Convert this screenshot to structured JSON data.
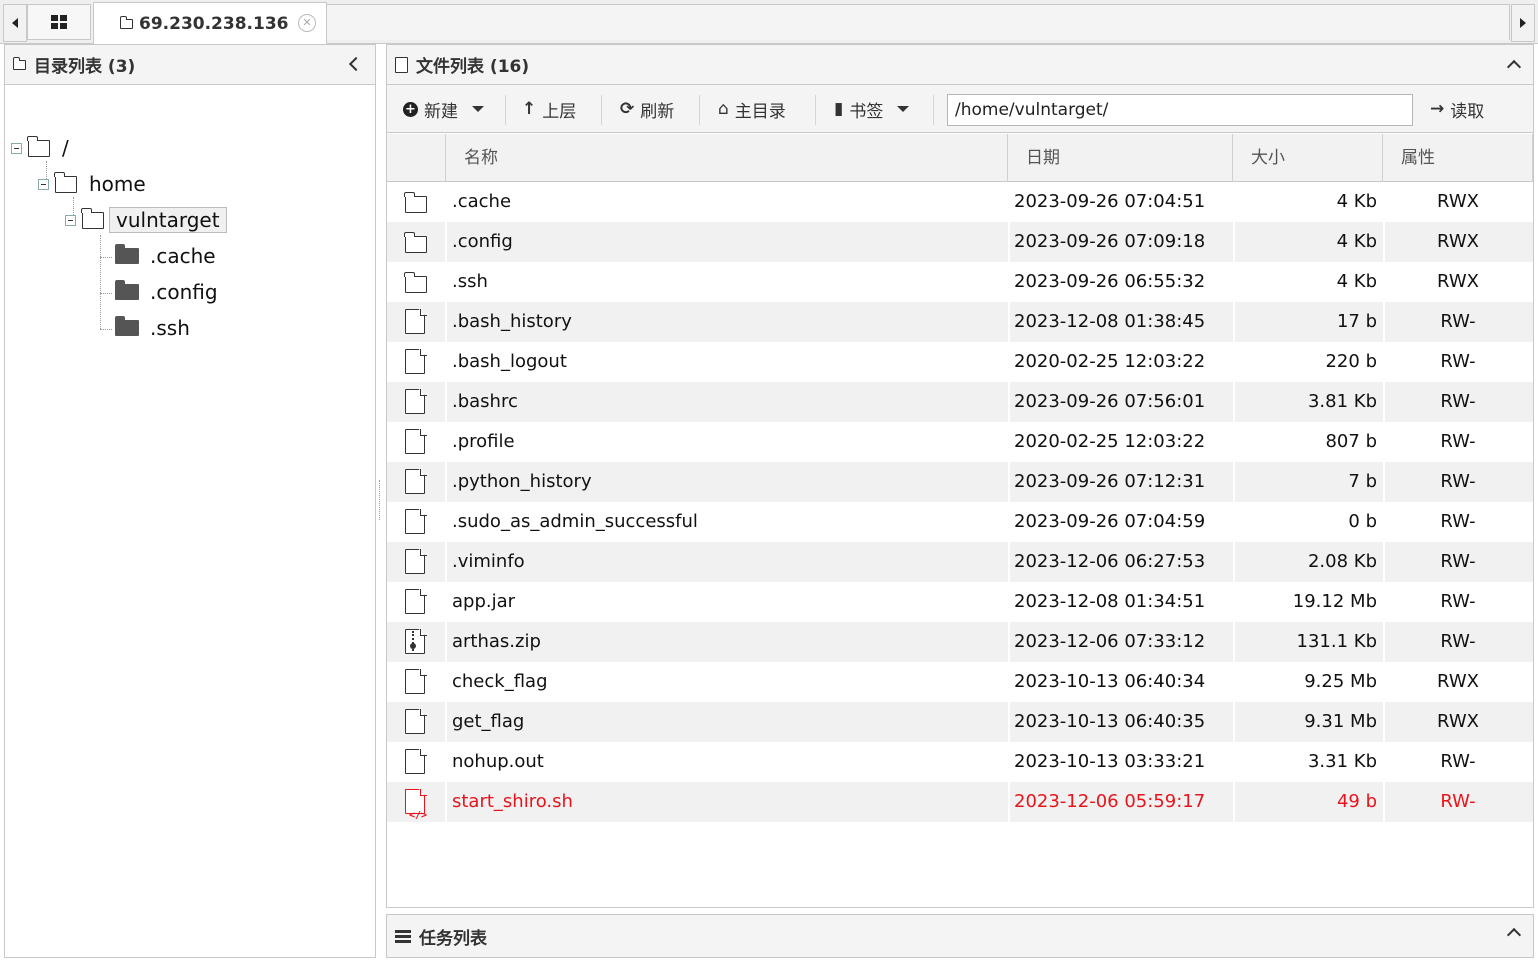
{
  "tabs": {
    "host_label": "69.230.238.136"
  },
  "left": {
    "title": "目录列表 (3)",
    "tree": {
      "root": "/",
      "home": "home",
      "user": "vulntarget",
      "children": [
        ".cache",
        ".config",
        ".ssh"
      ]
    }
  },
  "right": {
    "title": "文件列表 (16)",
    "toolbar": {
      "new_label": "新建",
      "up_label": "上层",
      "refresh_label": "刷新",
      "home_label": "主目录",
      "bookmark_label": "书签",
      "path_value": "/home/vulntarget/",
      "read_label": "读取"
    },
    "columns": [
      "名称",
      "日期",
      "大小",
      "属性"
    ],
    "files": [
      {
        "name": ".cache",
        "date": "2023-09-26 07:04:51",
        "size": "4 Kb",
        "attr": "RWX",
        "type": "folder"
      },
      {
        "name": ".config",
        "date": "2023-09-26 07:09:18",
        "size": "4 Kb",
        "attr": "RWX",
        "type": "folder"
      },
      {
        "name": ".ssh",
        "date": "2023-09-26 06:55:32",
        "size": "4 Kb",
        "attr": "RWX",
        "type": "folder"
      },
      {
        "name": ".bash_history",
        "date": "2023-12-08 01:38:45",
        "size": "17 b",
        "attr": "RW-",
        "type": "file"
      },
      {
        "name": ".bash_logout",
        "date": "2020-02-25 12:03:22",
        "size": "220 b",
        "attr": "RW-",
        "type": "file"
      },
      {
        "name": ".bashrc",
        "date": "2023-09-26 07:56:01",
        "size": "3.81 Kb",
        "attr": "RW-",
        "type": "file"
      },
      {
        "name": ".profile",
        "date": "2020-02-25 12:03:22",
        "size": "807 b",
        "attr": "RW-",
        "type": "file"
      },
      {
        "name": ".python_history",
        "date": "2023-09-26 07:12:31",
        "size": "7 b",
        "attr": "RW-",
        "type": "file"
      },
      {
        "name": ".sudo_as_admin_successful",
        "date": "2023-09-26 07:04:59",
        "size": "0 b",
        "attr": "RW-",
        "type": "file"
      },
      {
        "name": ".viminfo",
        "date": "2023-12-06 06:27:53",
        "size": "2.08 Kb",
        "attr": "RW-",
        "type": "file"
      },
      {
        "name": "app.jar",
        "date": "2023-12-08 01:34:51",
        "size": "19.12 Mb",
        "attr": "RW-",
        "type": "file"
      },
      {
        "name": "arthas.zip",
        "date": "2023-12-06 07:33:12",
        "size": "131.1 Kb",
        "attr": "RW-",
        "type": "zip"
      },
      {
        "name": "check_flag",
        "date": "2023-10-13 06:40:34",
        "size": "9.25 Mb",
        "attr": "RWX",
        "type": "file"
      },
      {
        "name": "get_flag",
        "date": "2023-10-13 06:40:35",
        "size": "9.31 Mb",
        "attr": "RWX",
        "type": "file"
      },
      {
        "name": "nohup.out",
        "date": "2023-10-13 03:33:21",
        "size": "3.31 Kb",
        "attr": "RW-",
        "type": "file"
      },
      {
        "name": "start_shiro.sh",
        "date": "2023-12-06 05:59:17",
        "size": "49 b",
        "attr": "RW-",
        "type": "script",
        "highlight": true
      }
    ]
  },
  "tasks": {
    "title": "任务列表"
  },
  "colors": {
    "highlight": "#e8141b",
    "row_alt": "#f1f1f1",
    "header_bg": "#f4f4f4"
  },
  "icons": {
    "tab": "folder-outline-icon",
    "grid": "grid-icon",
    "close": "close-circle-icon",
    "folder": "folder-outline-icon",
    "file": "file-icon",
    "zip": "zip-file-icon",
    "script": "code-file-icon"
  }
}
